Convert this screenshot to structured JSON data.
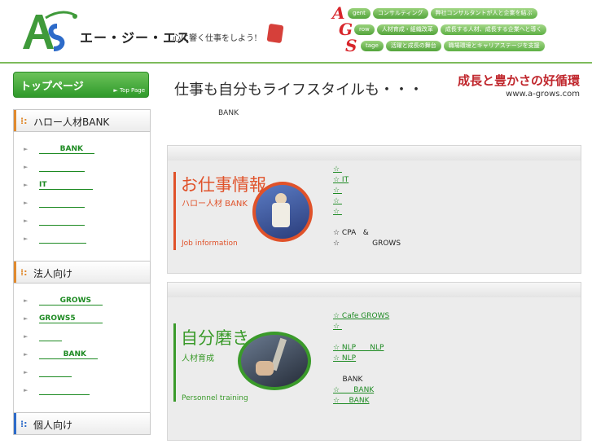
{
  "header": {
    "logo_text": "エー・ジー・エス",
    "logo_catch": "心に響く仕事をしよう!",
    "lines": [
      {
        "letter": "A",
        "word": "gent",
        "pills": [
          "コンサルティング",
          "弊社コンサルタントが人と企業を結ぶ"
        ]
      },
      {
        "letter": "G",
        "word": "row",
        "pills": [
          "人材育成・組織改革",
          "成長する人材、成長する企業へと導く"
        ]
      },
      {
        "letter": "S",
        "word": "tage",
        "pills": [
          "活躍と成長の舞台",
          "職場環境とキャリアステージを支援"
        ]
      }
    ]
  },
  "sidebar": {
    "top_button": {
      "label": "トップページ",
      "sub": "► Top Page"
    },
    "sections": [
      {
        "title": "ハロー人材BANK",
        "color": "#e08a2e",
        "items": [
          "BANK",
          "",
          "IT",
          "",
          "",
          ""
        ]
      },
      {
        "title": "法人向け",
        "color": "#e08a2e",
        "items": [
          "GROWS",
          "GROWS5",
          "",
          "BANK",
          "",
          ""
        ]
      },
      {
        "title": "個人向け",
        "color": "#2d6bc9",
        "items": []
      }
    ]
  },
  "main": {
    "slogan": "仕事も自分もライフスタイルも・・・",
    "slogan_right": "成長と豊かさの好循環",
    "url": "www.a-grows.com",
    "note": "BANK",
    "panels": [
      {
        "title": "お仕事情報",
        "subtitle": "ハロー人材 BANK",
        "en": "Job information",
        "accent": "#e0522a",
        "lines": [
          {
            "kind": "link",
            "text": "☆ "
          },
          {
            "kind": "link",
            "text": "☆ IT"
          },
          {
            "kind": "link",
            "text": "☆ "
          },
          {
            "kind": "link",
            "text": "☆ "
          },
          {
            "kind": "link",
            "text": "☆ "
          },
          {
            "kind": "gap",
            "text": ""
          },
          {
            "kind": "text",
            "text": "☆ CPA   &"
          },
          {
            "kind": "text",
            "text": "☆              GROWS"
          }
        ]
      },
      {
        "title": "自分磨き",
        "subtitle": "人材育成",
        "en": "Personnel training",
        "accent": "#3a9a2a",
        "lines": [
          {
            "kind": "link",
            "text": "☆ Cafe GROWS"
          },
          {
            "kind": "link",
            "text": "☆ "
          },
          {
            "kind": "gap",
            "text": ""
          },
          {
            "kind": "link",
            "text": "☆ NLP      NLP"
          },
          {
            "kind": "link",
            "text": "☆ NLP"
          },
          {
            "kind": "gap",
            "text": ""
          },
          {
            "kind": "text",
            "text": "    BANK"
          },
          {
            "kind": "link",
            "text": "☆      BANK"
          },
          {
            "kind": "link",
            "text": "☆    BANK"
          }
        ]
      }
    ]
  }
}
